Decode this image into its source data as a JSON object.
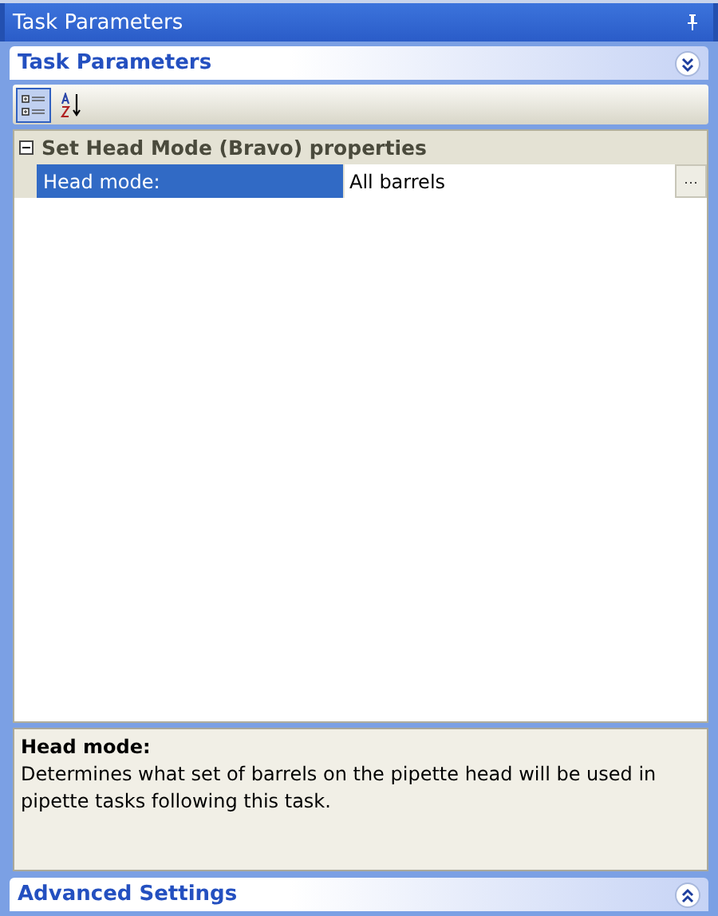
{
  "window": {
    "title": "Task Parameters"
  },
  "sections": [
    {
      "title": "Task Parameters",
      "expanded": true
    },
    {
      "title": "Advanced Settings",
      "expanded": false
    }
  ],
  "toolbar": [
    {
      "kind": "categorized",
      "selected": true
    },
    {
      "kind": "alphabetical",
      "selected": false
    }
  ],
  "category": {
    "title": "Set Head Mode (Bravo) properties",
    "expanded": true
  },
  "properties": [
    {
      "name": "Head mode:",
      "value": "All barrels",
      "selected": true,
      "button": "···"
    }
  ],
  "description": {
    "title": "Head mode:",
    "text": "Determines what set of barrels on the pipette head will be used in pipette tasks following this task."
  }
}
